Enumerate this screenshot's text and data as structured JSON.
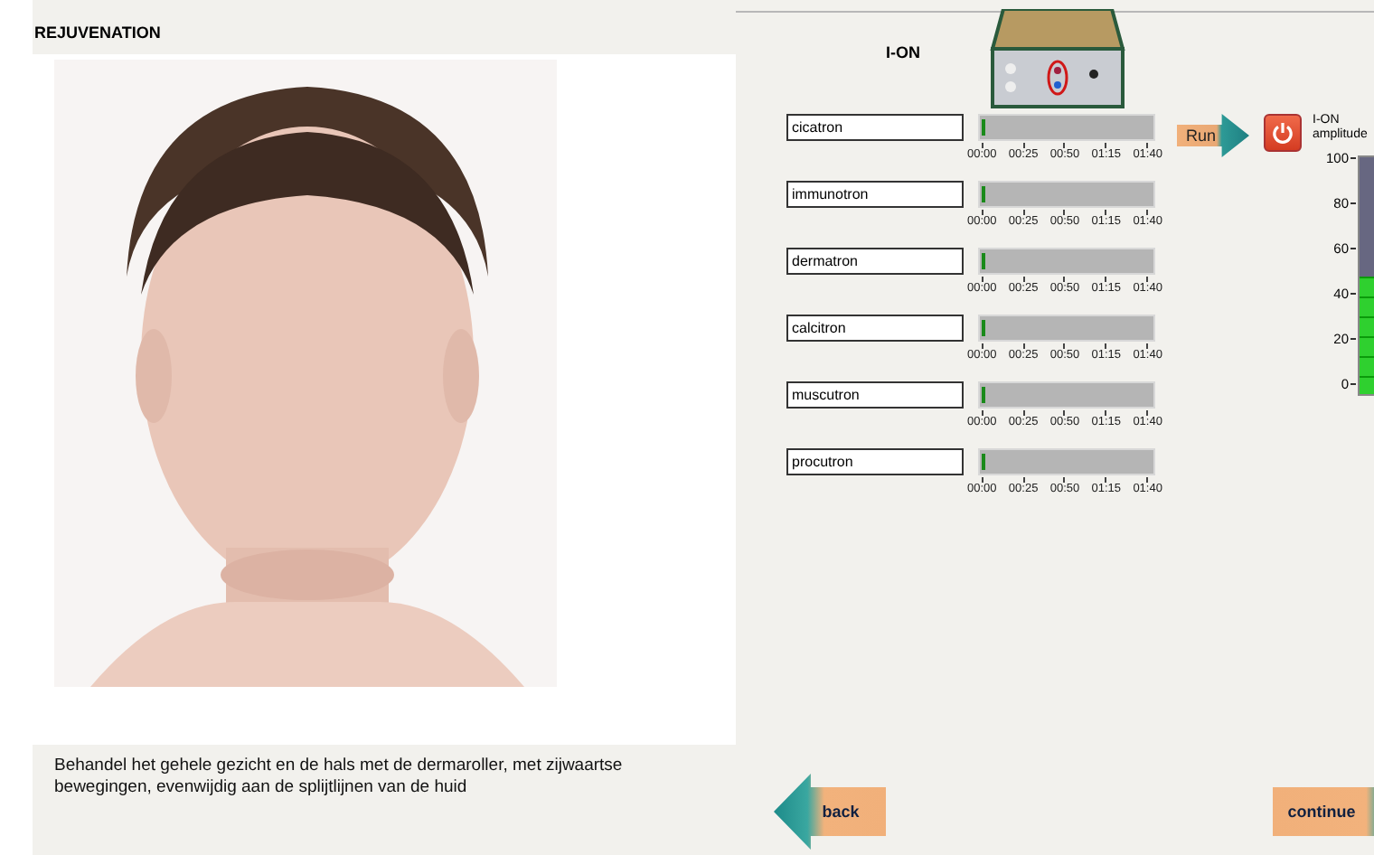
{
  "title": "REJUVENATION",
  "caption": "Behandel het gehele gezicht en de hals met de dermaroller, met zijwaartse bewegingen, evenwijdig aan de splijtlijnen van de huid",
  "device_label": "I-ON",
  "programs": [
    {
      "name": "cicatron",
      "level": 0,
      "ticks": [
        "00:00",
        "00:25",
        "00:50",
        "01:15",
        "01:40"
      ]
    },
    {
      "name": "immunotron",
      "level": 0,
      "ticks": [
        "00:00",
        "00:25",
        "00:50",
        "01:15",
        "01:40"
      ]
    },
    {
      "name": "dermatron",
      "level": 0,
      "ticks": [
        "00:00",
        "00:25",
        "00:50",
        "01:15",
        "01:40"
      ]
    },
    {
      "name": "calcitron",
      "level": 0,
      "ticks": [
        "00:00",
        "00:25",
        "00:50",
        "01:15",
        "01:40"
      ]
    },
    {
      "name": "muscutron",
      "level": 0,
      "ticks": [
        "00:00",
        "00:25",
        "00:50",
        "01:15",
        "01:40"
      ]
    },
    {
      "name": "procutron",
      "level": 0,
      "ticks": [
        "00:00",
        "00:25",
        "00:50",
        "01:15",
        "01:40"
      ]
    }
  ],
  "run_button": "Run",
  "meter": {
    "label": "I-ON amplitude",
    "level": 0.5,
    "ticks": [
      "100",
      "80",
      "60",
      "40",
      "20",
      "0"
    ]
  },
  "back_button": "back",
  "continue_button": "continue"
}
